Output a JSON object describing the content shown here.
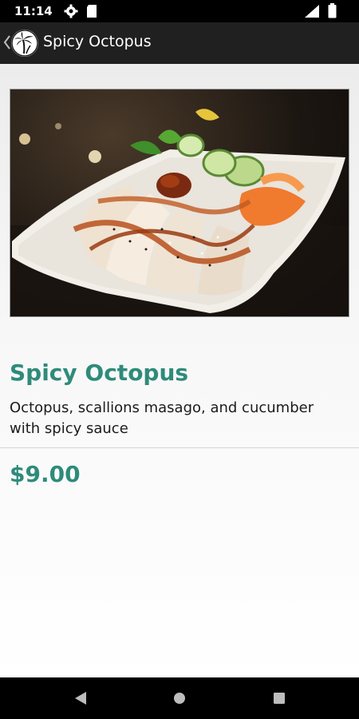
{
  "status_bar": {
    "time": "11:14",
    "icons": [
      "settings-icon",
      "sd-card-icon",
      "signal-icon",
      "battery-icon"
    ]
  },
  "app_bar": {
    "title": "Spicy Octopus",
    "back_icon": "chevron-left-icon",
    "logo_icon": "palm-tree-logo-icon"
  },
  "item": {
    "title": "Spicy Octopus",
    "description": "Octopus, scallions masago, and cucumber with spicy sauce",
    "price": "$9.00"
  },
  "colors": {
    "accent": "#2e8b7a",
    "app_bar": "#202020",
    "status_bar": "#000000"
  },
  "nav_bar": {
    "icons": [
      "back-triangle-icon",
      "home-circle-icon",
      "recents-square-icon"
    ]
  }
}
